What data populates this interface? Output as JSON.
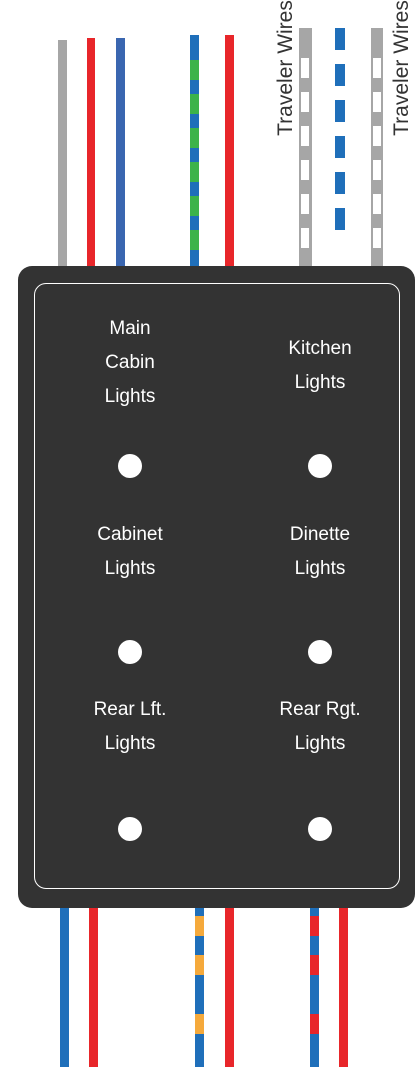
{
  "traveler_labels": [
    "Traveler Wires",
    "Traveler Wires"
  ],
  "switches": [
    {
      "lines": [
        "Main",
        "Cabin",
        "Lights"
      ]
    },
    {
      "lines": [
        "Kitchen",
        "Lights"
      ]
    },
    {
      "lines": [
        "Cabinet",
        "Lights"
      ]
    },
    {
      "lines": [
        "Dinette",
        "Lights"
      ]
    },
    {
      "lines": [
        "Rear Lft.",
        "Lights"
      ]
    },
    {
      "lines": [
        "Rear Rgt.",
        "Lights"
      ]
    }
  ],
  "colors": {
    "panel": "#333333",
    "wire_gray": "#a6a6a6",
    "wire_red": "#e8262a",
    "wire_blue": "#1f6fba",
    "wire_green": "#3cb34a",
    "wire_orange": "#f5a93b",
    "text_dark": "#333333"
  }
}
